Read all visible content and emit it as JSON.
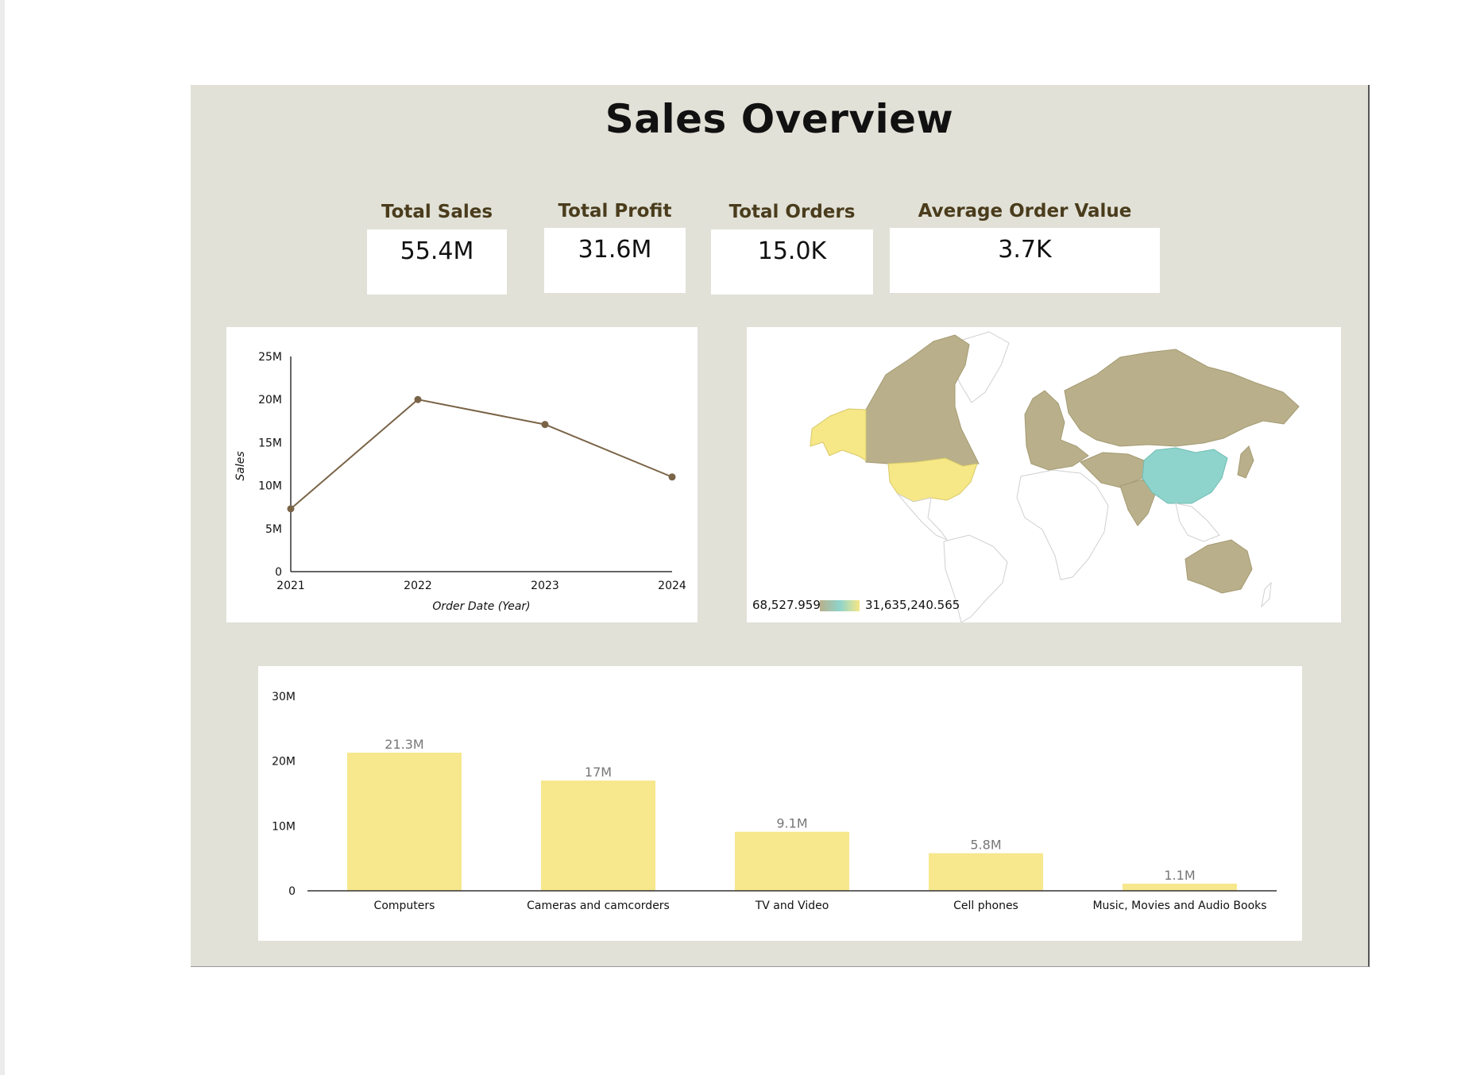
{
  "dashboard": {
    "title": "Sales Overview"
  },
  "kpis": [
    {
      "label": "Total Sales",
      "value": "55.4M"
    },
    {
      "label": "Total Profit",
      "value": "31.6M"
    },
    {
      "label": "Total Orders",
      "value": "15.0K"
    },
    {
      "label": "Average Order Value",
      "value": "3.7K"
    }
  ],
  "map_legend": {
    "min_label": "68,527.959",
    "max_label": "31,635,240.565"
  },
  "colors": {
    "line": "#7a6447",
    "bar": "#f7e78d",
    "map_low": "#b9b08b",
    "map_mid": "#8ed4cc",
    "map_high": "#f6e787"
  },
  "chart_data": [
    {
      "type": "line",
      "x": [
        "2021",
        "2022",
        "2023",
        "2024"
      ],
      "y": [
        7.3,
        20.0,
        17.1,
        11.0
      ],
      "y_unit": "M",
      "ylabel": "Sales",
      "xlabel": "Order Date (Year)",
      "yticks": [
        "0",
        "5M",
        "10M",
        "15M",
        "20M",
        "25M"
      ],
      "ylim": [
        0,
        25
      ],
      "grid": false
    },
    {
      "type": "bar",
      "categories": [
        "Computers",
        "Cameras and camcorders",
        "TV and Video",
        "Cell phones",
        "Music, Movies and Audio Books"
      ],
      "values": [
        21.3,
        17.0,
        9.1,
        5.8,
        1.1
      ],
      "value_labels": [
        "21.3M",
        "17M",
        "9.1M",
        "5.8M",
        "1.1M"
      ],
      "y_unit": "M",
      "yticks": [
        "0",
        "10M",
        "20M",
        "30M"
      ],
      "ylim": [
        0,
        30
      ],
      "grid": false
    }
  ]
}
